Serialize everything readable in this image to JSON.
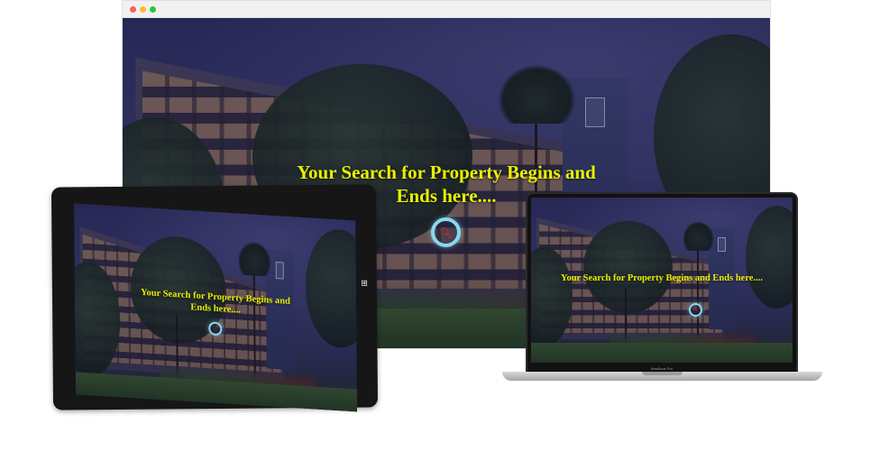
{
  "hero": {
    "heading": "Your Search for Property Begins and Ends here....",
    "search_icon": "search-icon",
    "heading_color": "#e8f000",
    "ring_color": "#8ad8ee",
    "search_icon_color": "#ff2020"
  },
  "desktop": {
    "window_controls": [
      "close-dot",
      "minimize-dot",
      "maximize-dot"
    ]
  },
  "tablet": {
    "logo_icon": "windows-logo-icon"
  },
  "laptop": {
    "model_label": "MacBook Pro"
  }
}
